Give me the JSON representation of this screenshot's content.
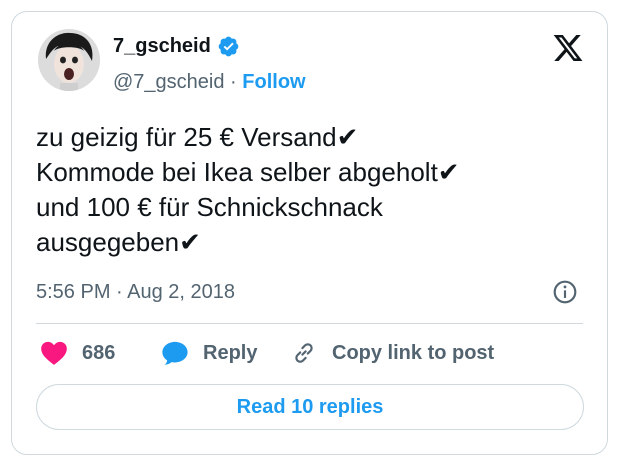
{
  "author": {
    "display_name": "7_gscheid",
    "handle": "@7_gscheid",
    "separator": "·",
    "follow_label": "Follow",
    "verified": true
  },
  "tweet": {
    "lines": [
      "zu geizig für 25 € Versand✔",
      "Kommode bei Ikea selber abgeholt✔",
      "und 100 € für Schnickschnack",
      "ausgegeben✔"
    ],
    "timestamp": "5:56 PM · Aug 2, 2018"
  },
  "actions": {
    "like_count": "686",
    "reply_label": "Reply",
    "copy_link_label": "Copy link to post"
  },
  "read_replies_label": "Read 10 replies",
  "colors": {
    "accent": "#1d9bf0",
    "like": "#f91880",
    "text": "#0f1419",
    "muted": "#536471",
    "border": "#cfd9de"
  },
  "icons": [
    "avatar-photo",
    "verified-badge-icon",
    "x-logo-icon",
    "info-icon",
    "heart-icon",
    "reply-bubble-icon",
    "link-icon"
  ]
}
